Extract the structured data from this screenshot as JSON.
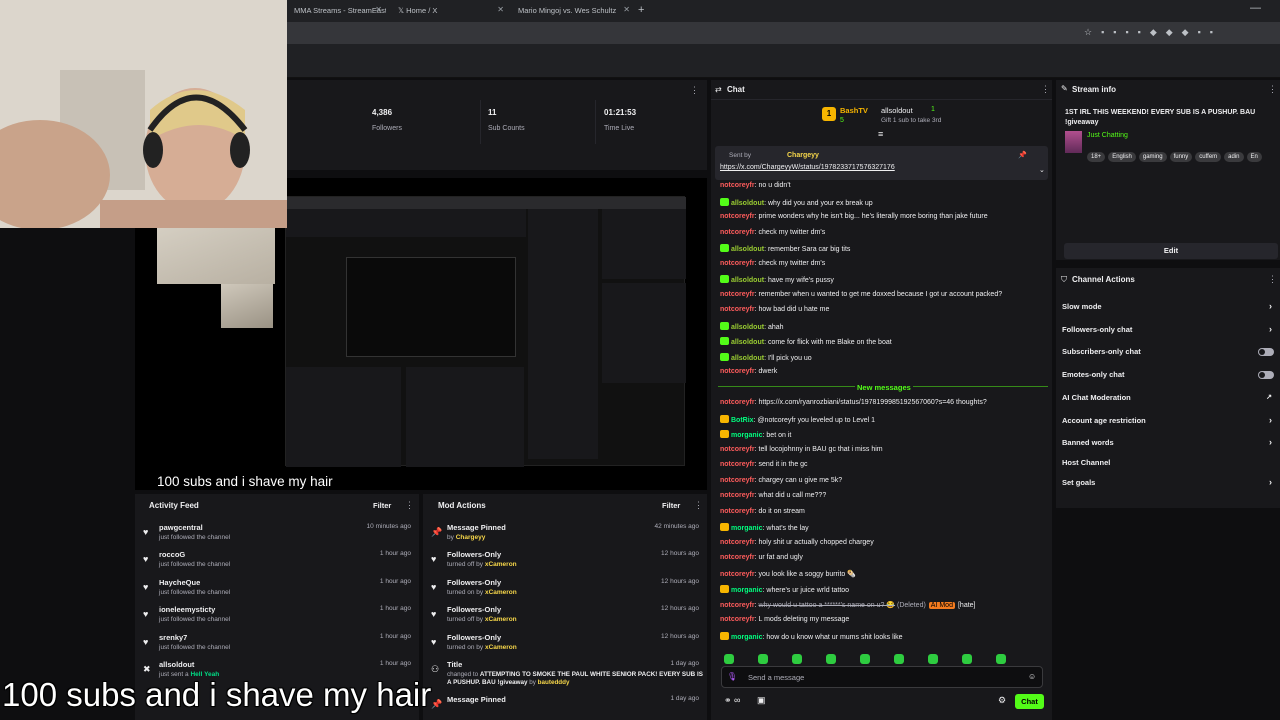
{
  "tabs": [
    {
      "label": "MMA Streams - StreamEast"
    },
    {
      "label": "Home / X"
    },
    {
      "label": "Mario Mingoj vs. Wes Schultz"
    }
  ],
  "stats": [
    {
      "value": "4,386",
      "label": "Followers"
    },
    {
      "value": "11",
      "label": "Sub Counts"
    },
    {
      "value": "01:21:53",
      "label": "Time Live"
    }
  ],
  "activity": {
    "title": "Activity Feed",
    "filter": "Filter",
    "items": [
      {
        "name": "pawgcentral",
        "desc": "just followed the channel",
        "time": "10 minutes ago"
      },
      {
        "name": "roccoG",
        "desc": "just followed the channel",
        "time": "1 hour ago"
      },
      {
        "name": "HaycheQue",
        "desc": "just followed the channel",
        "time": "1 hour ago"
      },
      {
        "name": "ioneleemysticty",
        "desc": "just followed the channel",
        "time": "1 hour ago"
      },
      {
        "name": "srenky7",
        "desc": "just followed the channel",
        "time": "1 hour ago"
      },
      {
        "name": "allsoldout",
        "desc": "just sent a",
        "desc_hl": "Hell Yeah",
        "time": "1 hour ago"
      }
    ]
  },
  "modactions": {
    "title": "Mod Actions",
    "filter": "Filter",
    "items": [
      {
        "title": "Message Pinned",
        "pre": "by",
        "who": "Chargeyy",
        "time": "42 minutes ago"
      },
      {
        "title": "Followers-Only",
        "pre": "turned off by",
        "who": "xCameron",
        "time": "12 hours ago"
      },
      {
        "title": "Followers-Only",
        "pre": "turned on by",
        "who": "xCameron",
        "time": "12 hours ago"
      },
      {
        "title": "Followers-Only",
        "pre": "turned off by",
        "who": "xCameron",
        "time": "12 hours ago"
      },
      {
        "title": "Followers-Only",
        "pre": "turned on by",
        "who": "xCameron",
        "time": "12 hours ago"
      },
      {
        "title": "Title",
        "pre": "changed to",
        "who": "ATTEMPTING TO SMOKE THE PAUL WHITE SENIOR PACK! EVERY SUB IS A PUSHUP. BAU !giveaway",
        "by": "by",
        "who2": "bautedddy",
        "time": "1 day ago"
      },
      {
        "title": "Message Pinned",
        "time": "1 day ago"
      }
    ]
  },
  "chat": {
    "title": "Chat",
    "leader1": "BashTV",
    "leader1_count": "5",
    "leader2": "allsoldout",
    "leader2_count": "1",
    "gift_text": "Gift 1 sub to take 3rd",
    "pinned_by": "Sent by",
    "pinned_user": "Chargeyy",
    "pinned_link": "https://x.com/ChargeyyW/status/1978233717576327176",
    "new_messages": "New messages",
    "input_placeholder": "Send a message",
    "send_label": "Chat",
    "messages": [
      {
        "user": "notcoreyfr",
        "c": "r",
        "text": "no u didn't"
      },
      {
        "user": "allsoldout",
        "c": "g",
        "text": "why did you and your ex break up"
      },
      {
        "user": "notcoreyfr",
        "c": "r",
        "text": "prime wonders why he isn't big... he's literally more boring than jake future"
      },
      {
        "user": "notcoreyfr",
        "c": "r",
        "text": "check my twitter dm's"
      },
      {
        "user": "allsoldout",
        "c": "g",
        "text": "remember Sara car big tits"
      },
      {
        "user": "notcoreyfr",
        "c": "r",
        "text": "check my twitter dm's"
      },
      {
        "user": "allsoldout",
        "c": "g",
        "text": "have my wife's pussy"
      },
      {
        "user": "notcoreyfr",
        "c": "r",
        "text": "remember when u wanted to get me doxxed because I got ur account packed?"
      },
      {
        "user": "notcoreyfr",
        "c": "r",
        "text": "how bad did u hate me"
      },
      {
        "user": "allsoldout",
        "c": "g",
        "text": "ahah"
      },
      {
        "user": "allsoldout",
        "c": "g",
        "text": "come for flick with me Blake on the boat"
      },
      {
        "user": "allsoldout",
        "c": "g",
        "text": "I'll pick you uo"
      },
      {
        "user": "notcoreyfr",
        "c": "r",
        "text": "dwerk"
      }
    ],
    "messages2": [
      {
        "user": "notcoreyfr",
        "c": "r",
        "text": "https://x.com/ryanrozbiani/status/1978199985192567060?s=46 thoughts?"
      },
      {
        "user": "BotRix",
        "c": "gn",
        "text": "@notcoreyfr you leveled up to Level 1"
      },
      {
        "user": "morganic",
        "c": "gn",
        "text": "bet on it"
      },
      {
        "user": "notcoreyfr",
        "c": "r",
        "text": "tell locojohnny in BAU gc that i miss him"
      },
      {
        "user": "notcoreyfr",
        "c": "r",
        "text": "send it in the gc"
      },
      {
        "user": "notcoreyfr",
        "c": "r",
        "text": "chargey can u give me 5k?"
      },
      {
        "user": "notcoreyfr",
        "c": "r",
        "text": "what did u call me???"
      },
      {
        "user": "notcoreyfr",
        "c": "r",
        "text": "do it on stream"
      },
      {
        "user": "morganic",
        "c": "gn",
        "text": "what's the lay"
      },
      {
        "user": "notcoreyfr",
        "c": "r",
        "text": "holy shit ur actually chopped chargey"
      },
      {
        "user": "notcoreyfr",
        "c": "r",
        "text": "ur fat and ugly"
      },
      {
        "user": "notcoreyfr",
        "c": "r",
        "text": "you look like a soggy burrito 🌯"
      },
      {
        "user": "morganic",
        "c": "gn",
        "text": "where's ur juice wrld tattoo"
      },
      {
        "user": "notcoreyfr",
        "c": "r",
        "text": "why would u tattoo a ******'s name on u? 😂",
        "deleted": "(Deleted)",
        "mod": "AI Mod",
        "reason": "[hate]"
      },
      {
        "user": "notcoreyfr",
        "c": "r",
        "text": "L mods deleting my message"
      },
      {
        "user": "morganic",
        "c": "gn",
        "text": "how do u know what ur mums shit looks like"
      }
    ]
  },
  "streaminfo": {
    "title": "Stream info",
    "stream_title": "1ST IRL THIS WEEKEND! EVERY SUB IS A PUSHUP. BAU !giveaway",
    "category": "Just Chatting",
    "tags": [
      "18+",
      "English",
      "gaming",
      "funny",
      "cuffem",
      "adin",
      "En"
    ],
    "edit": "Edit"
  },
  "actions": {
    "title": "Channel Actions",
    "items": [
      {
        "label": "Slow mode",
        "kind": "chev"
      },
      {
        "label": "Followers-only chat",
        "kind": "chev"
      },
      {
        "label": "Subscribers-only chat",
        "kind": "toggle"
      },
      {
        "label": "Emotes-only chat",
        "kind": "toggle"
      },
      {
        "label": "AI Chat Moderation",
        "kind": "ext"
      },
      {
        "label": "Account age restriction",
        "kind": "chev"
      },
      {
        "label": "Banned words",
        "kind": "chev"
      },
      {
        "label": "Host Channel",
        "kind": "none"
      },
      {
        "label": "Set goals",
        "kind": "chev"
      }
    ]
  },
  "captions": {
    "small": "100 subs and i shave my hair",
    "large": "100 subs and i shave my hair"
  },
  "colors": {
    "accent": "#53fc18",
    "bg": "#0e0e10",
    "panel": "#18181b"
  }
}
